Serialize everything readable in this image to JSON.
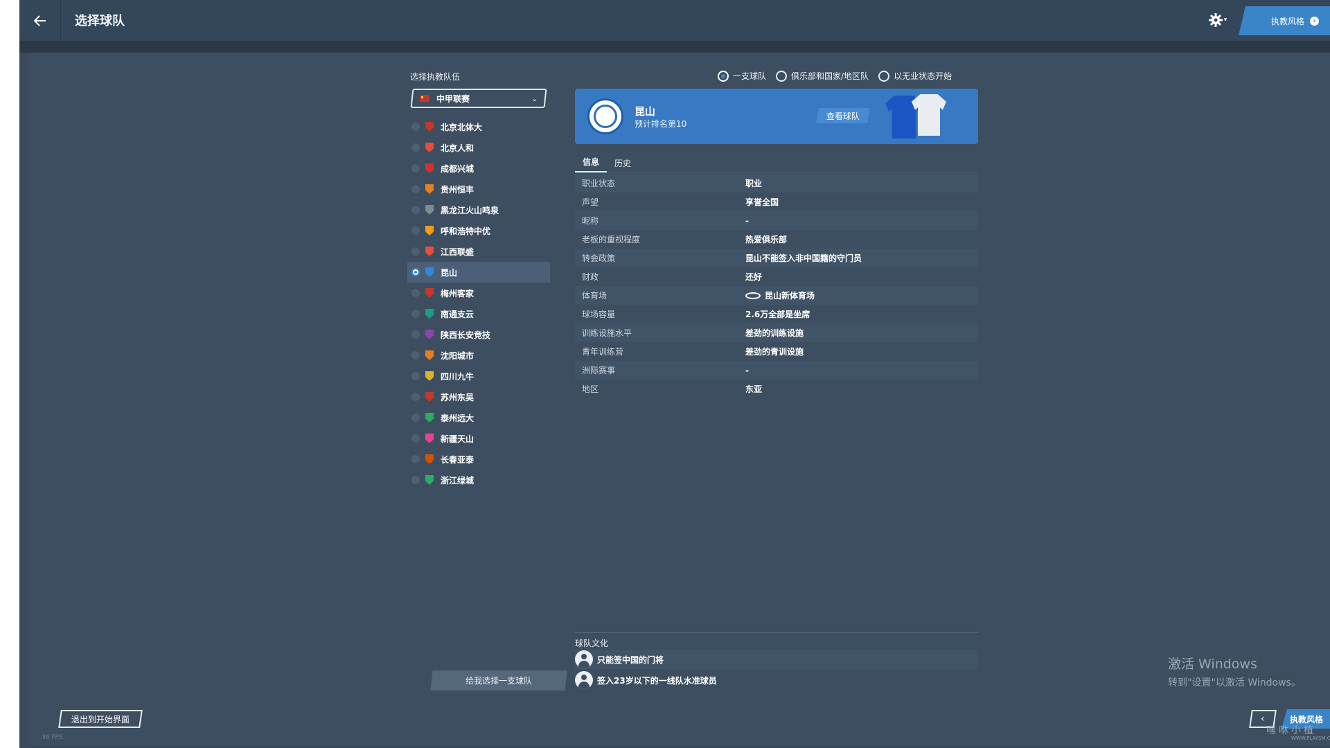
{
  "header": {
    "title": "选择球队",
    "style_button": "执教风格"
  },
  "left": {
    "label": "选择执教队伍",
    "league": "中甲联赛",
    "teams": [
      {
        "name": "北京北体大",
        "crest_color": "#c0392b",
        "selected": false
      },
      {
        "name": "北京人和",
        "crest_color": "#e74c3c",
        "selected": false
      },
      {
        "name": "成都兴城",
        "crest_color": "#d63031",
        "selected": false
      },
      {
        "name": "贵州恒丰",
        "crest_color": "#e67e22",
        "selected": false
      },
      {
        "name": "黑龙江火山鸣泉",
        "crest_color": "#7f8c8d",
        "selected": false
      },
      {
        "name": "呼和浩特中优",
        "crest_color": "#f39c12",
        "selected": false
      },
      {
        "name": "江西联盛",
        "crest_color": "#e74c3c",
        "selected": false
      },
      {
        "name": "昆山",
        "crest_color": "#2e86de",
        "selected": true
      },
      {
        "name": "梅州客家",
        "crest_color": "#c0392b",
        "selected": false
      },
      {
        "name": "南通支云",
        "crest_color": "#16a085",
        "selected": false
      },
      {
        "name": "陕西长安竞技",
        "crest_color": "#8e44ad",
        "selected": false
      },
      {
        "name": "沈阳城市",
        "crest_color": "#e67e22",
        "selected": false
      },
      {
        "name": "四川九牛",
        "crest_color": "#e1b12c",
        "selected": false
      },
      {
        "name": "苏州东吴",
        "crest_color": "#c0392b",
        "selected": false
      },
      {
        "name": "泰州远大",
        "crest_color": "#27ae60",
        "selected": false
      },
      {
        "name": "新疆天山",
        "crest_color": "#e84393",
        "selected": false
      },
      {
        "name": "长春亚泰",
        "crest_color": "#d35400",
        "selected": false
      },
      {
        "name": "浙江绿城",
        "crest_color": "#27ae60",
        "selected": false
      }
    ],
    "random_button": "给我选择一支球队"
  },
  "scope": {
    "options": [
      "一支球队",
      "俱乐部和国家/地区队",
      "以无业状态开始"
    ],
    "selected_index": 0
  },
  "team_card": {
    "name": "昆山",
    "rank": "预计排名第10",
    "view_button": "查看球队",
    "color": "#3779c2"
  },
  "tabs": [
    "信息",
    "历史"
  ],
  "info": [
    {
      "k": "职业状态",
      "v": "职业"
    },
    {
      "k": "声望",
      "v": "享誉全国"
    },
    {
      "k": "昵称",
      "v": "-"
    },
    {
      "k": "老板的重视程度",
      "v": "热爱俱乐部"
    },
    {
      "k": "转会政策",
      "v": "昆山不能签入非中国籍的守门员"
    },
    {
      "k": "财政",
      "v": "还好"
    },
    {
      "k": "体育场",
      "v": "昆山新体育场",
      "icon": "stadium-icon"
    },
    {
      "k": "球场容量",
      "v": "2.6万全部是坐席"
    },
    {
      "k": "训练设施水平",
      "v": "差劲的训练设施"
    },
    {
      "k": "青年训练营",
      "v": "差劲的青训设施"
    },
    {
      "k": "洲际赛事",
      "v": "-"
    },
    {
      "k": "地区",
      "v": "东亚"
    }
  ],
  "culture": {
    "title": "球队文化",
    "items": [
      "只能签中国的门将",
      "签入23岁以下的一线队水准球员"
    ]
  },
  "footer": {
    "exit": "退出到开始界面",
    "prev": "‹",
    "next": "执教风格",
    "fps": "36 FPS"
  },
  "overlay": {
    "win_line1": "激活 Windows",
    "win_line2": "转到\"设置\"以激活 Windows。",
    "watermark": "嘿咻小植",
    "watermark_url": "WWW.PLAYSM.CC"
  }
}
